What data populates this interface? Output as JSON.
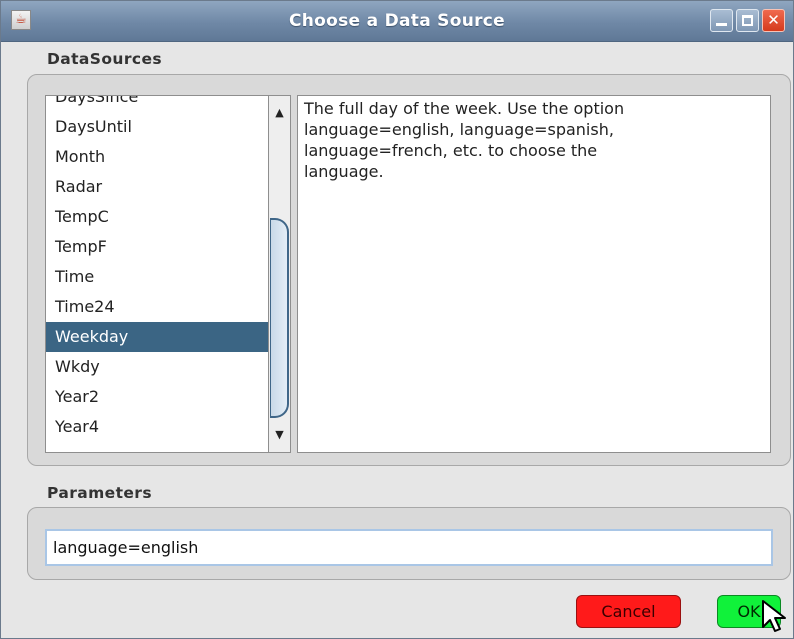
{
  "window": {
    "title": "Choose a Data Source"
  },
  "icons": {
    "app": "java-cup-icon",
    "minimize": "minimize-icon",
    "maximize": "maximize-icon",
    "close": "close-icon",
    "cursor": "mouse-pointer-icon"
  },
  "datasources": {
    "label": "DataSources",
    "items": [
      "DaysSince",
      "DaysUntil",
      "Month",
      "Radar",
      "TempC",
      "TempF",
      "Time",
      "Time24",
      "Weekday",
      "Wkdy",
      "Year2",
      "Year4"
    ],
    "selected": "Weekday",
    "description": "The full day of the week. Use the option\nlanguage=english, language=spanish,\nlanguage=french, etc. to choose the\nlanguage."
  },
  "parameters": {
    "label": "Parameters",
    "value": "language=english"
  },
  "buttons": {
    "cancel": "Cancel",
    "ok": "OK"
  },
  "colors": {
    "selection": "#3b6584",
    "cancel": "#ff1a1a",
    "ok": "#10f23a",
    "titlebar": "#7089a7"
  }
}
